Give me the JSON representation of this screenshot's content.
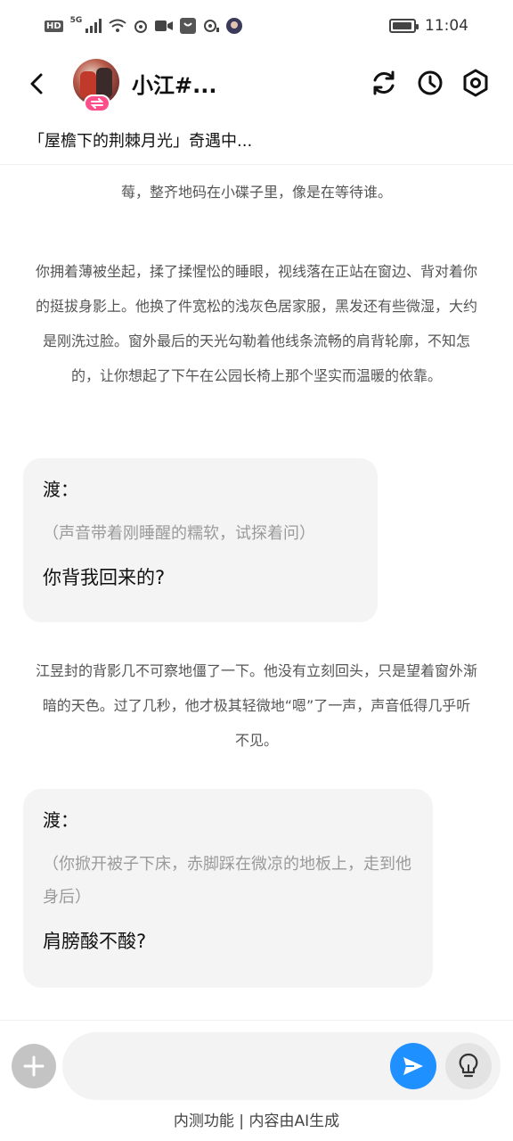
{
  "status_bar": {
    "hd": "HD",
    "network": "5G",
    "time": "11:04"
  },
  "header": {
    "title": "小江#...",
    "subtitle": "「屋檐下的荆棘月光」奇遇中..."
  },
  "chat": {
    "narration_0": "莓，整齐地码在小碟子里，像是在等待谁。",
    "narration_1": "你拥着薄被坐起，揉了揉惺忪的睡眼，视线落在正站在窗边、背对着你的挺拔身影上。他换了件宽松的浅灰色居家服，黑发还有些微湿，大约是刚洗过脸。窗外最后的天光勾勒着他线条流畅的肩背轮廓，不知怎的，让你想起了下午在公园长椅上那个坚实而温暖的依靠。",
    "message_1": {
      "speaker": "渡：",
      "action": "（声音带着刚睡醒的糯软，试探着问）",
      "speech": "你背我回来的?"
    },
    "narration_2": "江昱封的背影几不可察地僵了一下。他没有立刻回头，只是望着窗外渐暗的天色。过了几秒，他才极其轻微地“嗯”了一声，声音低得几乎听不见。",
    "message_2": {
      "speaker": "渡：",
      "action": "（你掀开被子下床，赤脚踩在微凉的地板上，走到他身后）",
      "speech": "肩膀酸不酸?"
    }
  },
  "input": {
    "placeholder": "",
    "footer": "内测功能 | 内容由AI生成"
  },
  "colors": {
    "send_button": "#1e90ff",
    "badge": "#ff4f8b",
    "bubble_bg": "#f3f4f3"
  }
}
